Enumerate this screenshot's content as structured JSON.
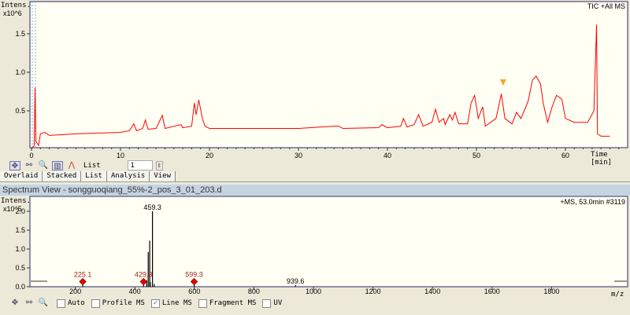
{
  "chromatogram": {
    "y_label": "Intens.",
    "y_exp": "x10^6",
    "trace_label": "TIC +All MS",
    "x_label": "Time [min]",
    "y_ticks": [
      "0.5",
      "1.0",
      "1.5"
    ],
    "x_ticks": [
      "0",
      "10",
      "20",
      "30",
      "40",
      "50",
      "60"
    ],
    "color": "#ff0000",
    "points": [
      [
        0,
        0
      ],
      [
        0.3,
        0.05
      ],
      [
        0.4,
        0.8
      ],
      [
        0.5,
        0.1
      ],
      [
        0.8,
        0.05
      ],
      [
        1,
        0.2
      ],
      [
        1.5,
        0.22
      ],
      [
        2,
        0.18
      ],
      [
        5,
        0.2
      ],
      [
        10,
        0.22
      ],
      [
        11,
        0.24
      ],
      [
        11.5,
        0.33
      ],
      [
        11.8,
        0.24
      ],
      [
        12.5,
        0.27
      ],
      [
        12.8,
        0.38
      ],
      [
        13.1,
        0.26
      ],
      [
        14,
        0.27
      ],
      [
        14.7,
        0.44
      ],
      [
        15,
        0.27
      ],
      [
        16.8,
        0.32
      ],
      [
        17,
        0.28
      ],
      [
        18,
        0.3
      ],
      [
        18.3,
        0.6
      ],
      [
        18.5,
        0.45
      ],
      [
        18.8,
        0.64
      ],
      [
        19.2,
        0.4
      ],
      [
        19.5,
        0.3
      ],
      [
        20,
        0.27
      ],
      [
        25,
        0.27
      ],
      [
        30,
        0.27
      ],
      [
        34,
        0.3
      ],
      [
        34.5,
        0.3
      ],
      [
        35,
        0.27
      ],
      [
        39,
        0.28
      ],
      [
        39.4,
        0.32
      ],
      [
        40,
        0.28
      ],
      [
        41.5,
        0.3
      ],
      [
        41.8,
        0.4
      ],
      [
        42.2,
        0.29
      ],
      [
        43,
        0.32
      ],
      [
        43.5,
        0.45
      ],
      [
        44,
        0.3
      ],
      [
        45,
        0.35
      ],
      [
        45.4,
        0.52
      ],
      [
        45.8,
        0.35
      ],
      [
        46.3,
        0.4
      ],
      [
        46.5,
        0.32
      ],
      [
        47,
        0.45
      ],
      [
        47.3,
        0.38
      ],
      [
        47.6,
        0.48
      ],
      [
        48,
        0.33
      ],
      [
        49,
        0.33
      ],
      [
        49.4,
        0.6
      ],
      [
        49.8,
        0.7
      ],
      [
        50.2,
        0.4
      ],
      [
        50.7,
        0.55
      ],
      [
        51,
        0.3
      ],
      [
        52.2,
        0.4
      ],
      [
        52.8,
        0.72
      ],
      [
        53.2,
        0.4
      ],
      [
        54,
        0.33
      ],
      [
        54.5,
        0.48
      ],
      [
        55,
        0.4
      ],
      [
        55.8,
        0.62
      ],
      [
        56.3,
        0.9
      ],
      [
        56.7,
        0.95
      ],
      [
        57.2,
        0.85
      ],
      [
        57.5,
        0.6
      ],
      [
        58,
        0.35
      ],
      [
        58.5,
        0.55
      ],
      [
        59,
        0.7
      ],
      [
        59.6,
        0.65
      ],
      [
        60,
        0.4
      ],
      [
        61,
        0.35
      ],
      [
        62.5,
        0.35
      ],
      [
        63.2,
        0.5
      ],
      [
        63.5,
        1.62
      ],
      [
        63.6,
        0.2
      ],
      [
        64,
        0.17
      ],
      [
        65,
        0.17
      ]
    ],
    "marker_time": 53.0
  },
  "toolbar": {
    "list_label": "List",
    "list_value": "1"
  },
  "tabs": [
    "Overlaid",
    "Stacked",
    "List",
    "Analysis",
    "View"
  ],
  "spectrum": {
    "title": "Spectrum View - songguoqiang_55%-2_pos_3_01_203.d",
    "y_label": "Intens.",
    "y_exp": "x10^5",
    "info": "+MS, 53.0min #3119",
    "x_label": "m/z",
    "y_ticks": [
      "0.0",
      "0.5",
      "1.0",
      "1.5",
      "2.0"
    ],
    "x_ticks": [
      "200",
      "400",
      "600",
      "800",
      "1000",
      "1200",
      "1400",
      "1600",
      "1800"
    ],
    "peaks": [
      [
        225.1,
        0.03
      ],
      [
        429.3,
        0.03
      ],
      [
        440,
        0.15
      ],
      [
        445,
        0.9
      ],
      [
        450,
        1.2
      ],
      [
        452,
        0.1
      ],
      [
        459.3,
        1.98
      ],
      [
        465,
        0.05
      ],
      [
        599.3,
        0.03
      ],
      [
        939.6,
        0.02
      ]
    ],
    "labels": [
      {
        "text": "459.3",
        "mz": 459.3,
        "y": 1.98,
        "precursor": false
      },
      {
        "text": "225.1",
        "mz": 225.1,
        "y": 0.03,
        "precursor": true
      },
      {
        "text": "429.3",
        "mz": 429.3,
        "y": 0.03,
        "precursor": true
      },
      {
        "text": "599.3",
        "mz": 599.3,
        "y": 0.03,
        "precursor": true
      },
      {
        "text": "939.6",
        "mz": 939.6,
        "y": 0.02,
        "precursor": false
      }
    ]
  },
  "bottom": {
    "options": [
      {
        "label": "Auto",
        "checked": false
      },
      {
        "label": "Profile MS",
        "checked": false
      },
      {
        "label": "Line MS",
        "checked": true
      },
      {
        "label": "Fragment MS",
        "checked": false
      },
      {
        "label": "UV",
        "checked": false
      }
    ]
  }
}
